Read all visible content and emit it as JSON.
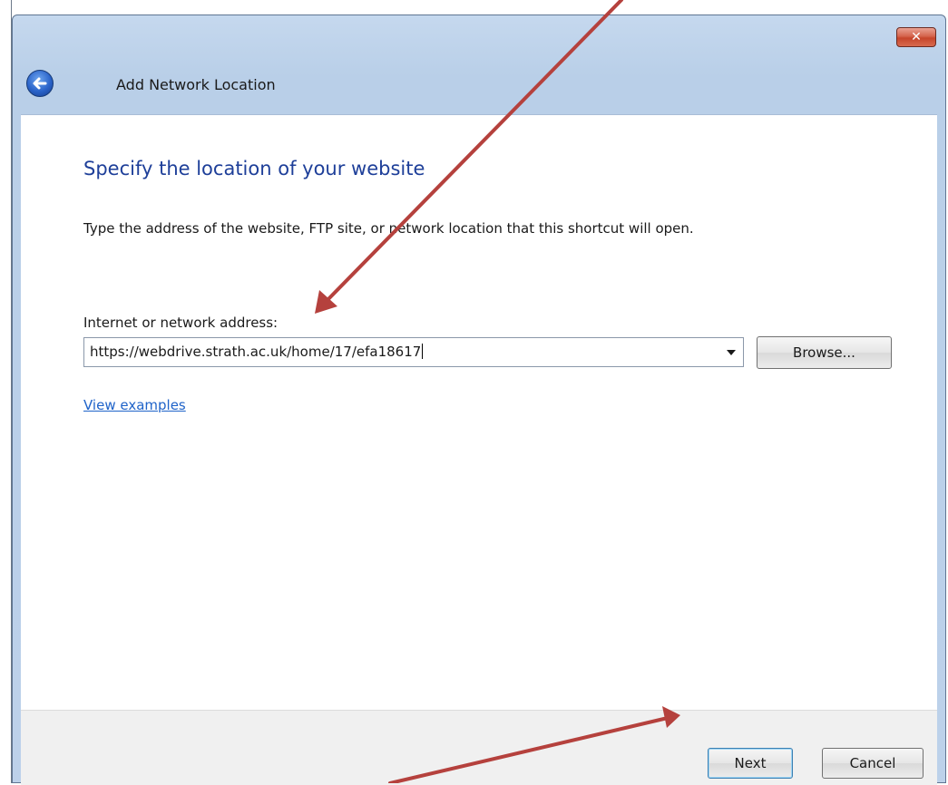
{
  "window": {
    "close_glyph": "✕"
  },
  "header": {
    "title": "Add Network Location"
  },
  "content": {
    "heading": "Specify the location of your website",
    "instructions": "Type the address of the website, FTP site, or network location that this shortcut will open.",
    "address_label": "Internet or network address:",
    "address_value": "https://webdrive.strath.ac.uk/home/17/efa18617",
    "browse_label": "Browse...",
    "view_examples_label": "View examples"
  },
  "footer": {
    "next_label": "Next",
    "cancel_label": "Cancel"
  },
  "colors": {
    "heading": "#1e3f99",
    "link": "#1f63c9",
    "annotation_arrow": "#b5413d",
    "window_frame": "#bcd1ea"
  },
  "icons": {
    "back": "back-arrow-icon",
    "close": "close-icon",
    "dropdown": "chevron-down-icon"
  }
}
